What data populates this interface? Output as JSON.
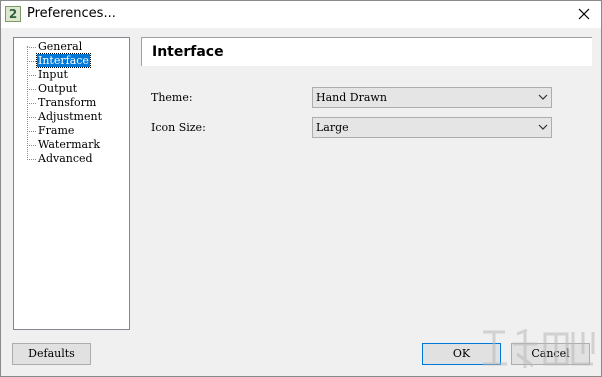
{
  "window": {
    "title": "Preferences...",
    "app_icon_glyph": "2"
  },
  "tree": {
    "items": [
      {
        "label": "General",
        "selected": false
      },
      {
        "label": "Interface",
        "selected": true
      },
      {
        "label": "Input",
        "selected": false
      },
      {
        "label": "Output",
        "selected": false
      },
      {
        "label": "Transform",
        "selected": false
      },
      {
        "label": "Adjustment",
        "selected": false
      },
      {
        "label": "Frame",
        "selected": false
      },
      {
        "label": "Watermark",
        "selected": false
      },
      {
        "label": "Advanced",
        "selected": false
      }
    ]
  },
  "panel": {
    "title": "Interface",
    "theme": {
      "label": "Theme:",
      "value": "Hand Drawn"
    },
    "icon_size": {
      "label": "Icon Size:",
      "value": "Large"
    }
  },
  "buttons": {
    "defaults": "Defaults",
    "ok": "OK",
    "cancel": "Cancel"
  },
  "colors": {
    "selection": "#0078d7",
    "window_bg": "#f0f0f0"
  }
}
